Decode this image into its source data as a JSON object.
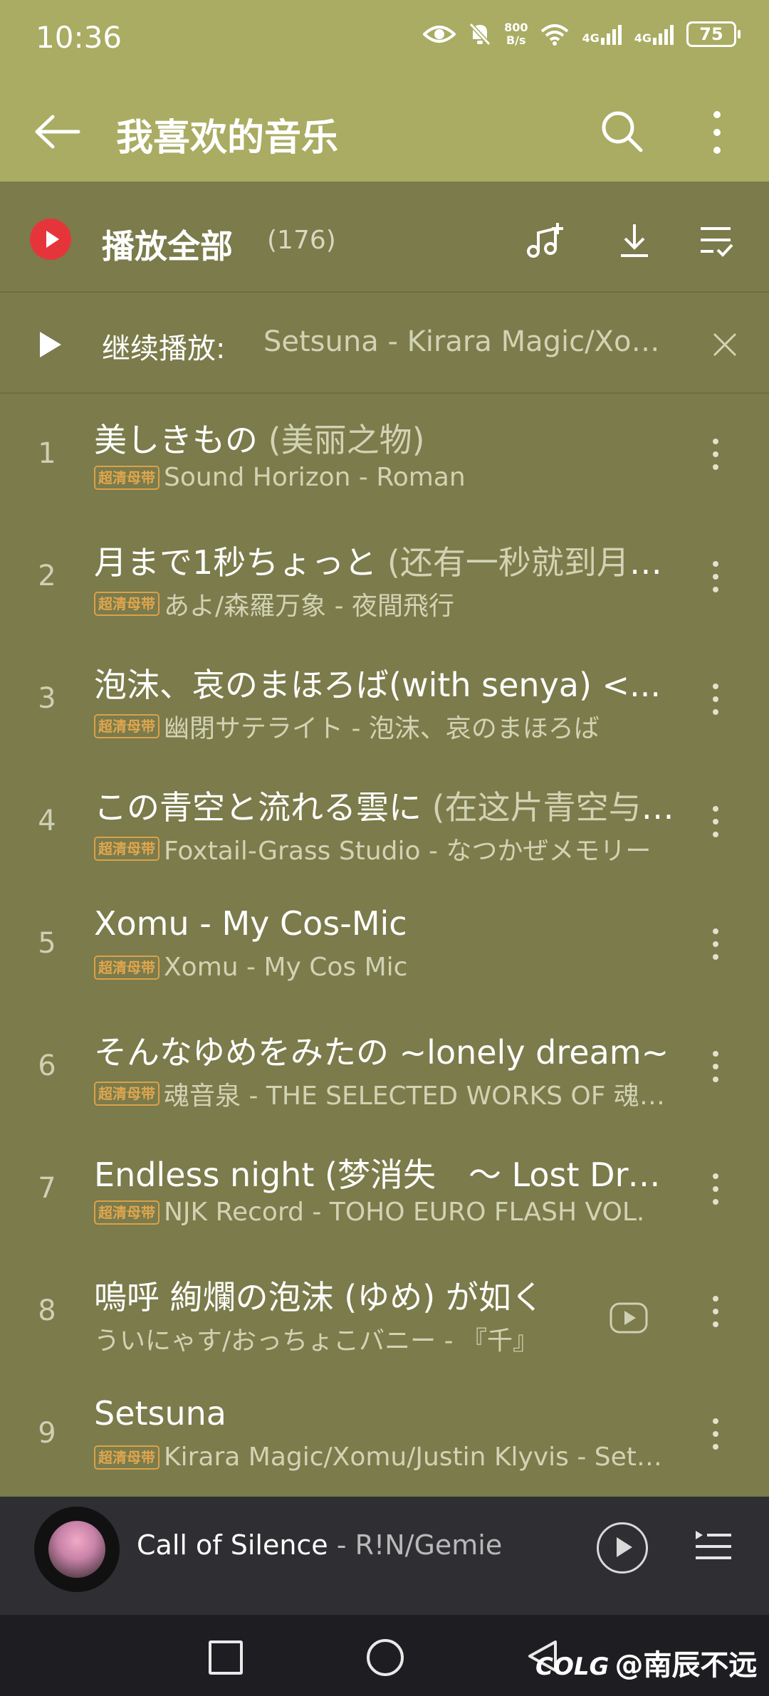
{
  "status_bar": {
    "time": "10:36",
    "net_speed_value": "800",
    "net_speed_unit": "B/s",
    "signal_1": "4G",
    "signal_2": "4G",
    "battery": "75"
  },
  "header": {
    "title": "我喜欢的音乐"
  },
  "play_all": {
    "label": "播放全部",
    "count": "(176)"
  },
  "continue": {
    "label": "继续播放:",
    "song": "Setsuna - Kirara Magic/Xomu/Justin Klyvis"
  },
  "badge_label": "超清母带",
  "songs": [
    {
      "num": "1",
      "title": "美しきもの",
      "alt": " (美丽之物)",
      "meta": "Sound Horizon - Roman",
      "badge": true
    },
    {
      "num": "2",
      "title": "月まで1秒ちょっと",
      "alt": " (还有一秒就到月亮)",
      "meta": "あよ/森羅万象 - 夜間飛行",
      "badge": true
    },
    {
      "num": "3",
      "title": "泡沫、哀のまほろば(with senya) <...",
      "alt": "",
      "meta": "幽閉サテライト - 泡沫、哀のまほろば",
      "badge": true
    },
    {
      "num": "4",
      "title": "この青空と流れる雲に",
      "alt": " (在这片青空与流云)",
      "meta": "Foxtail-Grass Studio - なつかぜメモリー",
      "badge": true
    },
    {
      "num": "5",
      "title": "Xomu - My Cos-Mic",
      "alt": "",
      "meta": "Xomu - My Cos Mic",
      "badge": true
    },
    {
      "num": "6",
      "title": "そんなゆめをみたの ~lonely dream~",
      "alt": "",
      "meta": "魂音泉 - THE SELECTED WORKS OF 魂音泉",
      "badge": true
    },
    {
      "num": "7",
      "title": "Endless night (梦消失　～ Lost Dream)",
      "alt": "",
      "meta": "NJK Record - TOHO EURO FLASH VOL.",
      "badge": true
    },
    {
      "num": "8",
      "title": "嗚呼 絢爛の泡沫 (ゆめ) が如く",
      "alt": "",
      "meta": "ういにゃす/おっちょこバニー - 『千』",
      "badge": false,
      "mv": true
    },
    {
      "num": "9",
      "title": "Setsuna",
      "alt": "",
      "meta": "Kirara Magic/Xomu/Justin Klyvis - Setsuna",
      "badge": true
    }
  ],
  "now_playing": {
    "title": "Call of Silence",
    "sep": " - ",
    "artist": "R!N/Gemie"
  },
  "watermark": {
    "logo": "COLG",
    "handle": "@南辰不远"
  }
}
